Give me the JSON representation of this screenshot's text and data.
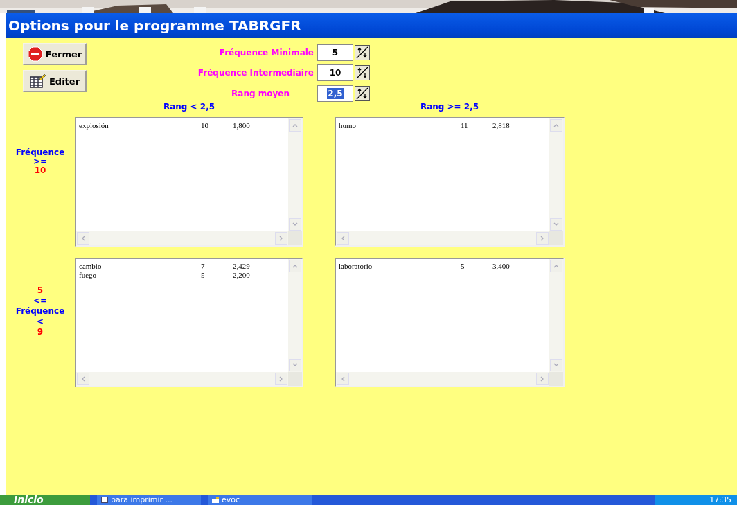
{
  "desktop_strip": {
    "kind": "picture"
  },
  "window": {
    "title": "Options pour le programme TABRGFR"
  },
  "buttons": [
    {
      "label": "Fermer",
      "kind": "stop"
    },
    {
      "label": "Editer",
      "kind": "edit"
    }
  ],
  "spinners": [
    {
      "label": "Fréquence Minimale",
      "value": "5",
      "highlighted": false
    },
    {
      "label": "Fréquence Intermediaire",
      "value": "10",
      "highlighted": false
    },
    {
      "label": "Rang moyen",
      "value": "2,5",
      "highlighted": true
    }
  ],
  "column_headers": [
    "Rang < 2,5",
    "Rang >= 2,5"
  ],
  "row_labels": [
    [
      {
        "text": "Fréquence",
        "kind": "word"
      },
      {
        "text": ">=",
        "kind": "word"
      },
      {
        "text": "10",
        "kind": "number"
      }
    ],
    [
      {
        "text": "5",
        "kind": "number"
      },
      {
        "text": "<=",
        "kind": "word"
      },
      {
        "text": "Fréquence",
        "kind": "word"
      },
      {
        "text": "<",
        "kind": "word"
      },
      {
        "text": "9",
        "kind": "number"
      }
    ]
  ],
  "lists": [
    [
      {
        "word": "explosión",
        "frequency": "10",
        "rank": "1,800"
      }
    ],
    [
      {
        "word": "humo",
        "frequency": "11",
        "rank": "2,818"
      }
    ],
    [
      {
        "word": "cambio",
        "frequency": "7",
        "rank": "2,429"
      },
      {
        "word": "fuego",
        "frequency": "5",
        "rank": "2,200"
      }
    ],
    [
      {
        "word": "laboratorio",
        "frequency": "5",
        "rank": "3,400"
      }
    ]
  ],
  "taskbar": {
    "start": "Inicio",
    "tasks": [
      {
        "label": "para imprimir ...",
        "kind": "doc"
      },
      {
        "label": "evoc",
        "kind": "app"
      }
    ],
    "clock": "17:35"
  }
}
